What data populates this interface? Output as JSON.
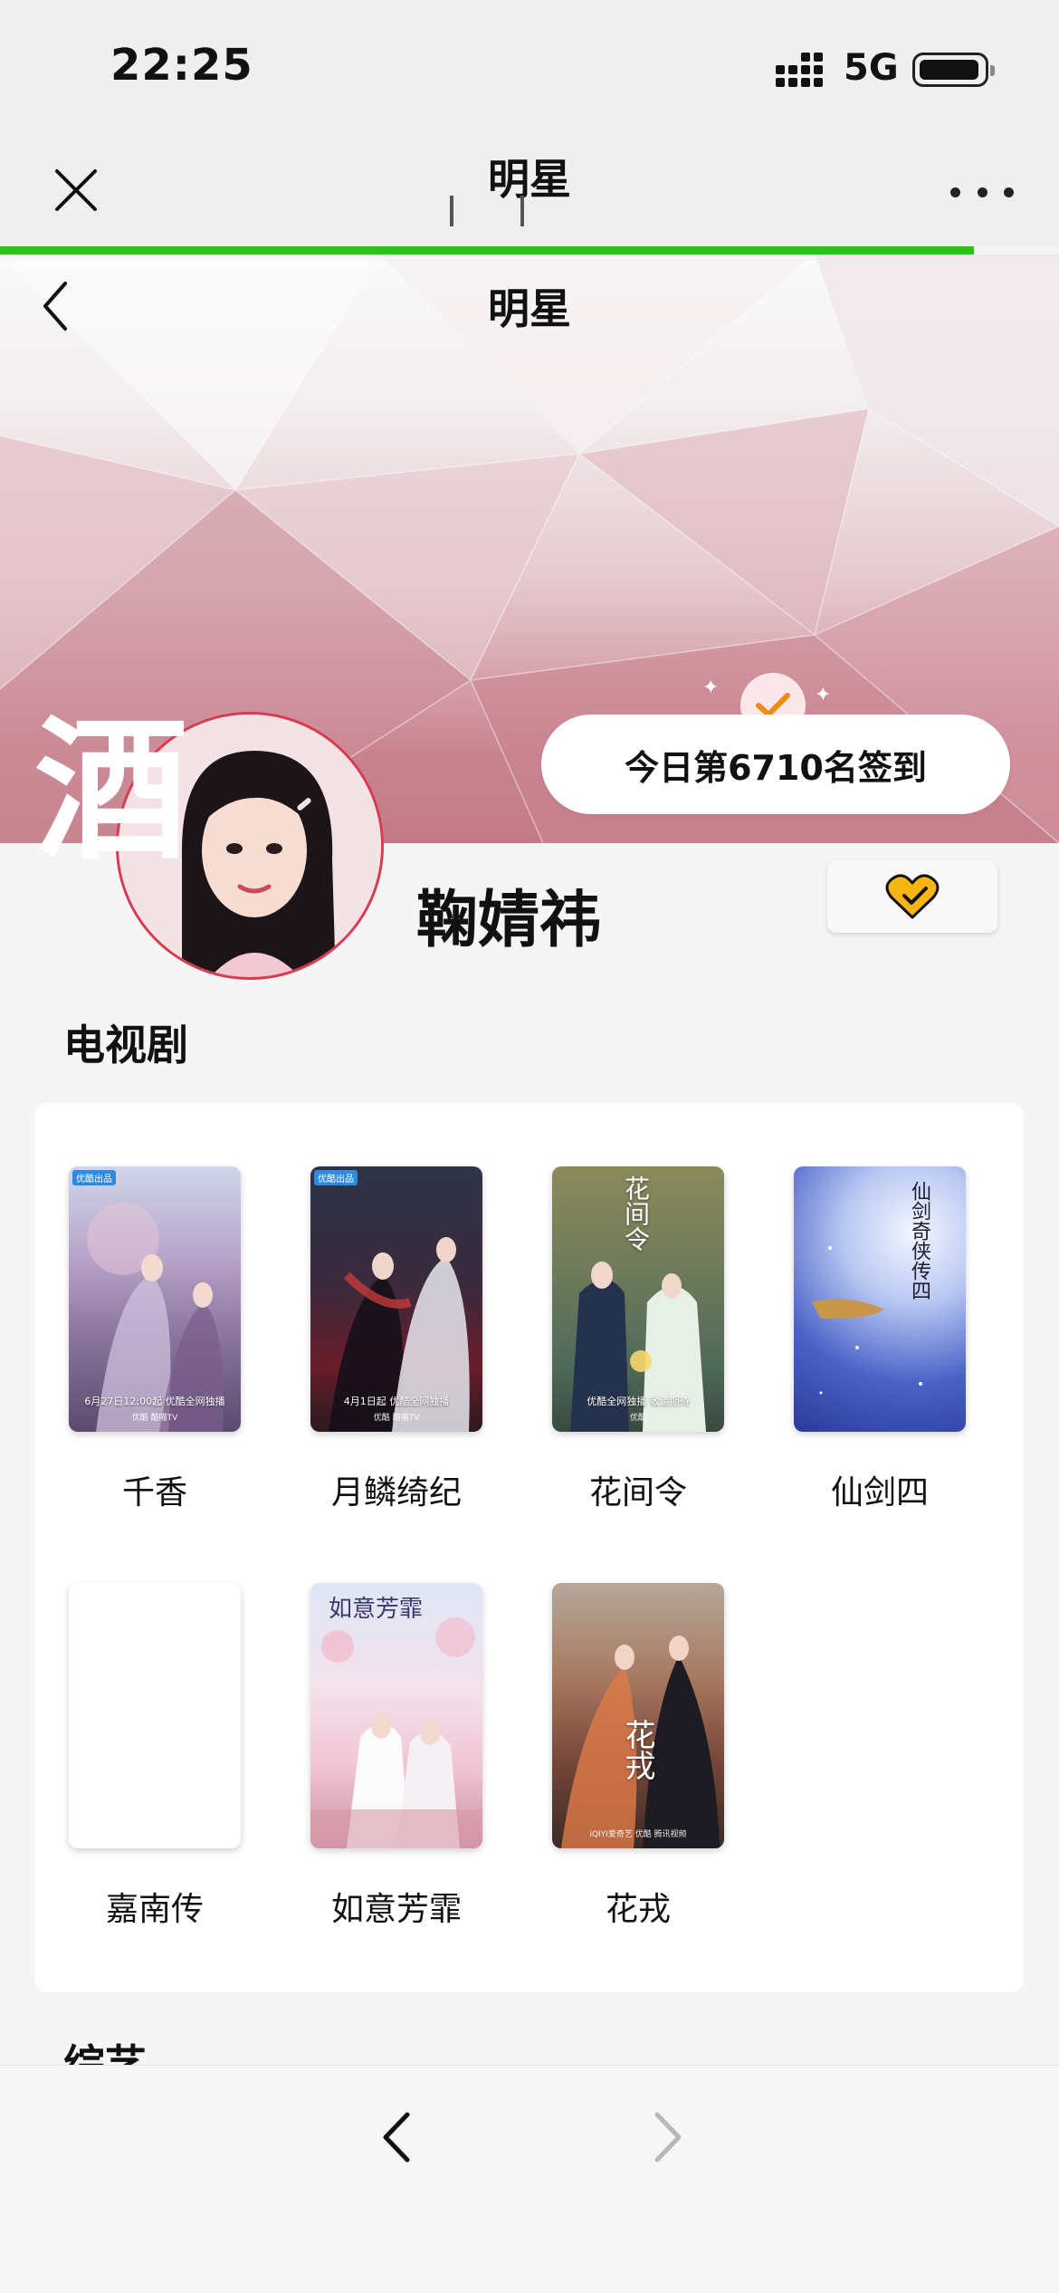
{
  "status_bar": {
    "time": "22:25",
    "network": "5G"
  },
  "title_bar": {
    "title": "明星",
    "progress_percent": 92
  },
  "banner": {
    "title": "明星",
    "checkin_text": "今日第6710名签到"
  },
  "profile": {
    "logo_char": "酒",
    "name": "鞠婧祎"
  },
  "tv_section": {
    "title": "电视剧",
    "shows": [
      {
        "title": "千香"
      },
      {
        "title": "月鳞绮纪"
      },
      {
        "title": "花间令"
      },
      {
        "title": "仙剑四"
      },
      {
        "title": "嘉南传"
      },
      {
        "title": "如意芳霏"
      },
      {
        "title": "花戎"
      }
    ]
  },
  "next_section": {
    "title": "综艺"
  },
  "posters": {
    "p1": {
      "tag": "优酷出品",
      "caption": "6月27日12:00起 优酷全网独播",
      "sub": "优酷 酷喵TV"
    },
    "p2": {
      "tag": "优酷出品",
      "caption": "4月1日起 优酷全网独播",
      "sub": "优酷 酷喵TV"
    },
    "p3": {
      "vtitle": "花间令",
      "caption": "优酷全网独播 敬请期待",
      "sub": "优酷"
    },
    "p4": {
      "vtitle": "仙剑奇侠传四"
    },
    "p6": {
      "vtitle": "如意芳霏"
    },
    "p7": {
      "vtitle": "花戎",
      "sub": "iQIYI爱奇艺 优酷 腾讯视频"
    }
  },
  "colors": {
    "progress": "#2ec11b",
    "accent_red": "#d93a4e",
    "checkmark": "#f08a17",
    "heart_yellow": "#f7b514"
  }
}
